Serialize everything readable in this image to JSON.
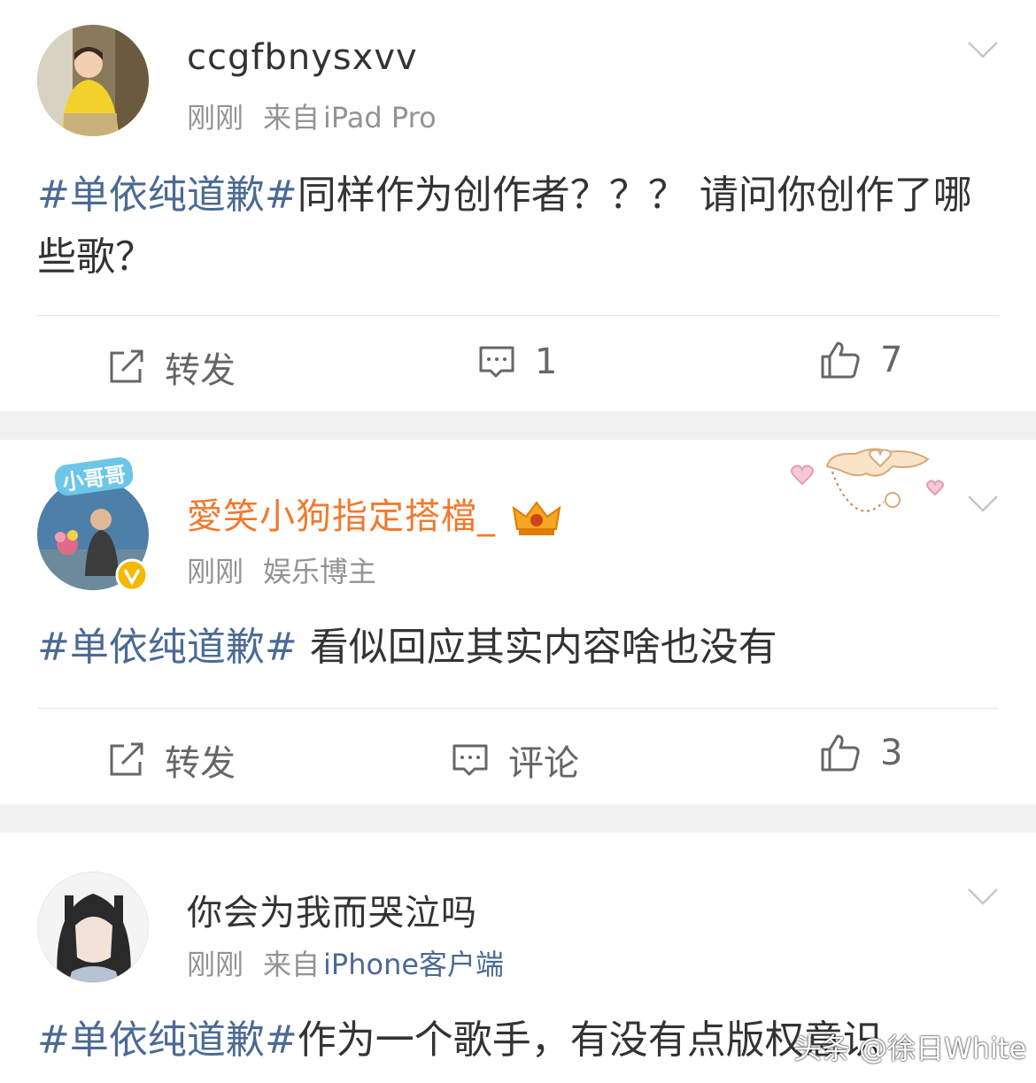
{
  "posts": [
    {
      "username": "ccgfbnysxvv",
      "time": "刚刚",
      "source_prefix": "来自",
      "source": "iPad Pro",
      "hashtag": "#单依纯道歉#",
      "text": "同样作为创作者？？？ 请问你创作了哪些歌？",
      "repost_label": "转发",
      "comment_label": "1",
      "like_count": "7"
    },
    {
      "avatar_badge": "小哥哥",
      "username": "愛笑小狗指定搭檔_",
      "time": "刚刚",
      "verified_title": "娱乐博主",
      "hashtag": "#单依纯道歉#",
      "text": " 看似回应其实内容啥也没有",
      "repost_label": "转发",
      "comment_label": "评论",
      "like_count": "3"
    },
    {
      "username": "你会为我而哭泣吗",
      "time": "刚刚",
      "source_prefix": "来自",
      "source": "iPhone客户端",
      "hashtag": "#单依纯道歉#",
      "text": "作为一个歌手，有没有点版权意识"
    }
  ],
  "watermark": "头条 @徐日White",
  "colors": {
    "hashtag": "#4b6a94",
    "username_vip": "#f07a2e",
    "separator": "#f1f1f1",
    "verified_badge": "#f5b800"
  },
  "icons": [
    "chevron-down-icon",
    "repost-icon",
    "comment-icon",
    "like-icon",
    "verified-icon",
    "crown-icon",
    "heart-icon"
  ]
}
